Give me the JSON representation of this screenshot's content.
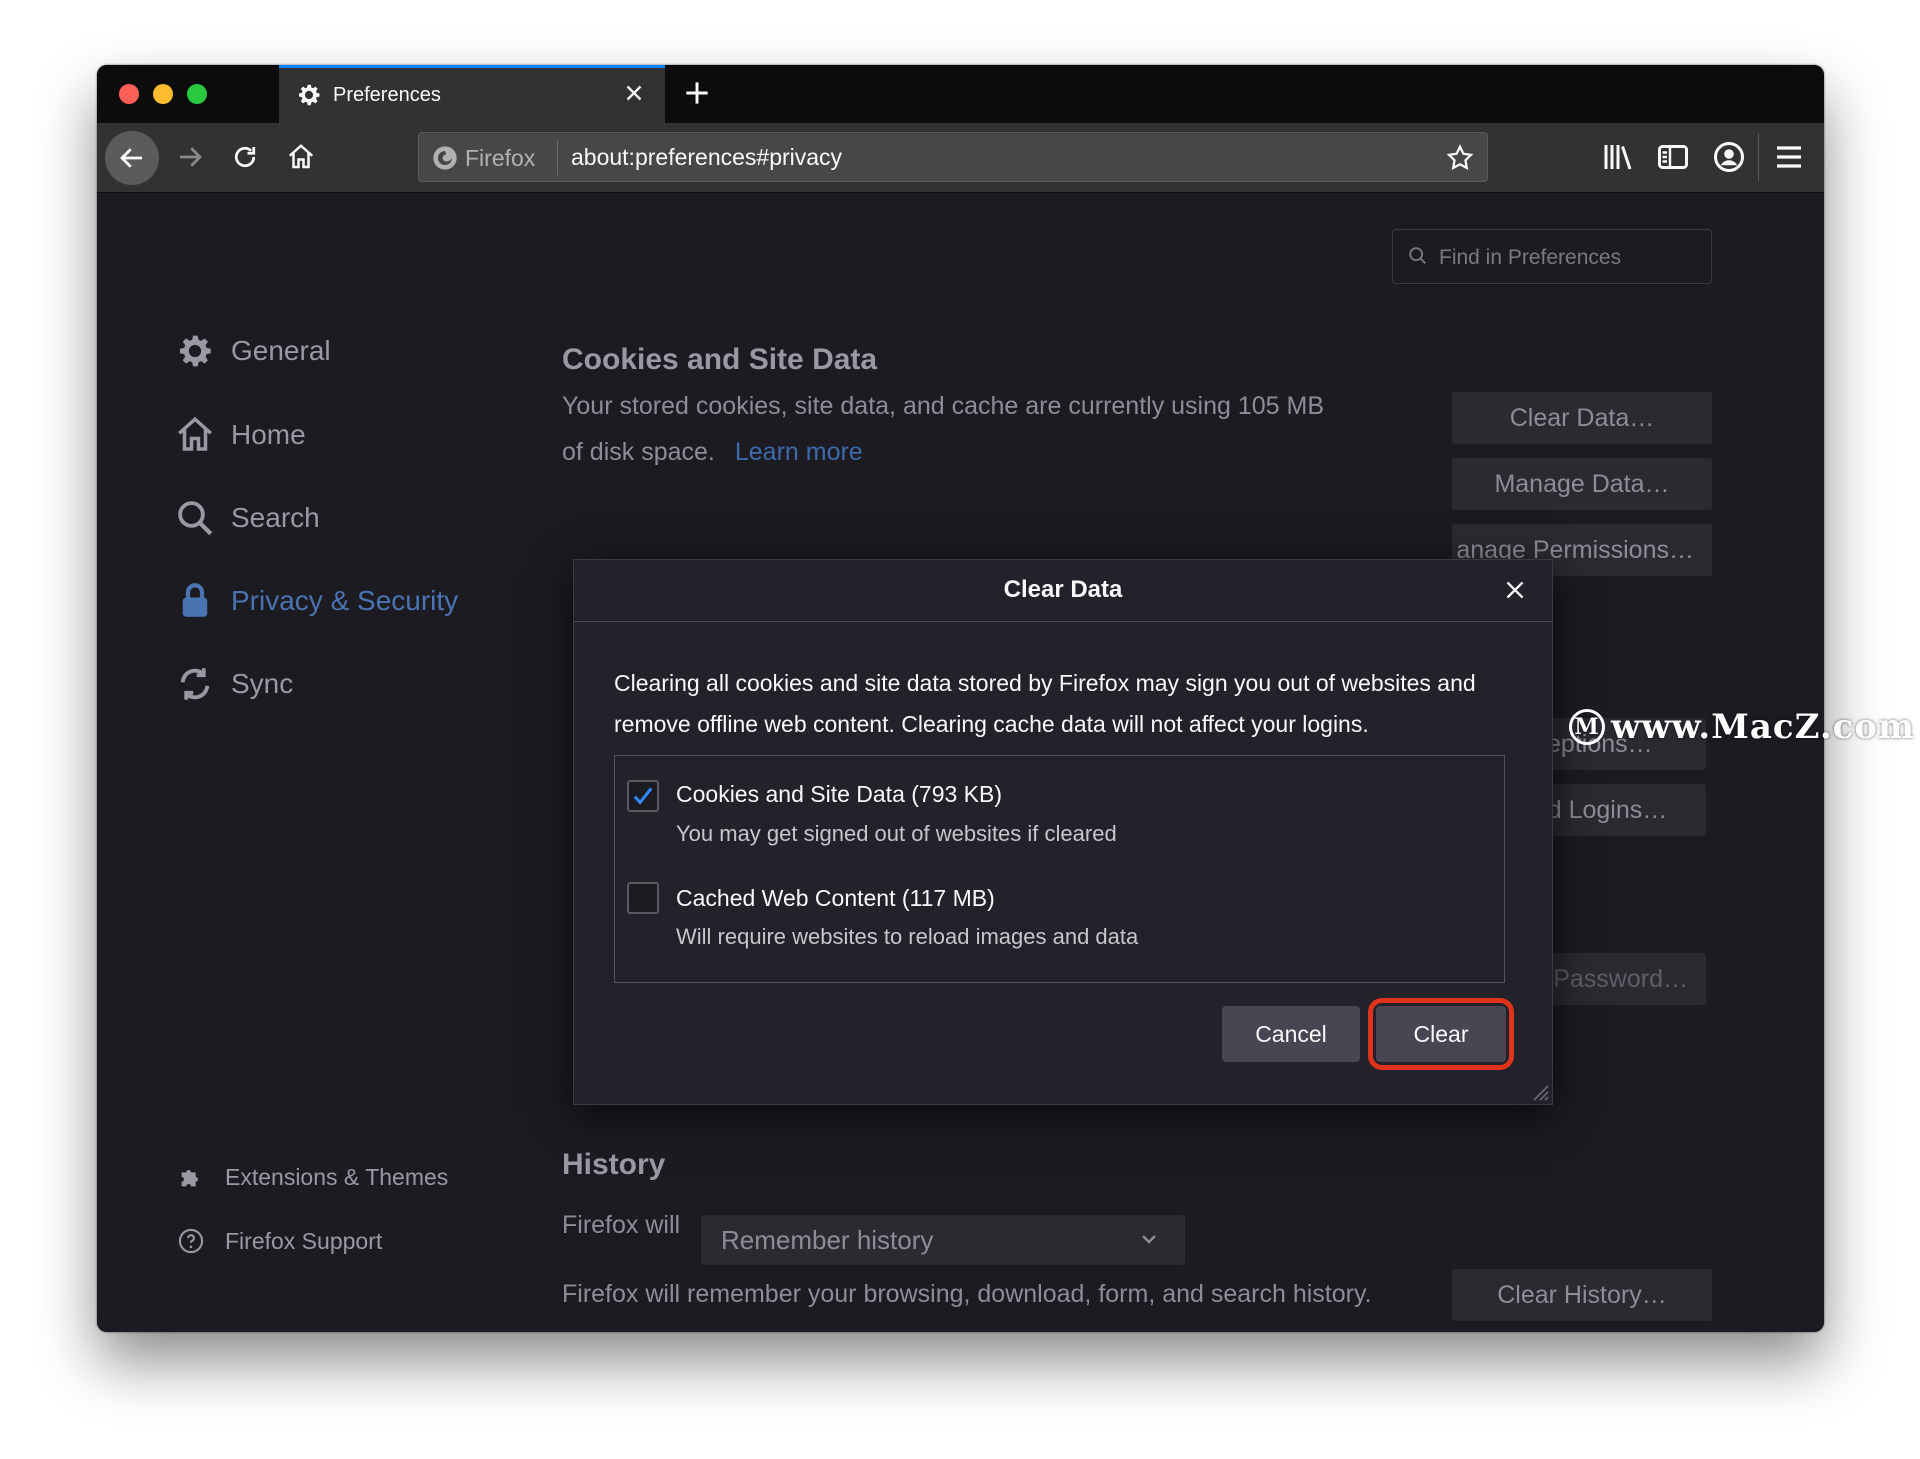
{
  "window": {
    "tab_title": "Preferences",
    "url_identity": "Firefox",
    "url": "about:preferences#privacy"
  },
  "search": {
    "placeholder": "Find in Preferences"
  },
  "sidebar": {
    "items": [
      {
        "label": "General",
        "icon": "gear-icon"
      },
      {
        "label": "Home",
        "icon": "home-icon"
      },
      {
        "label": "Search",
        "icon": "search-icon"
      },
      {
        "label": "Privacy & Security",
        "icon": "lock-icon",
        "active": true
      },
      {
        "label": "Sync",
        "icon": "sync-icon"
      }
    ],
    "footer": [
      {
        "label": "Extensions & Themes",
        "icon": "puzzle-icon"
      },
      {
        "label": "Firefox Support",
        "icon": "help-icon"
      }
    ]
  },
  "cookies": {
    "title": "Cookies and Site Data",
    "desc_line1": "Your stored cookies, site data, and cache are currently using 105 MB",
    "desc_line2": "of disk space.",
    "learn_more": "Learn more",
    "buttons": {
      "clear_data": "Clear Data…",
      "manage_data": "Manage Data…",
      "manage_permissions": "anage Permissions…"
    }
  },
  "logins": {
    "exceptions": "Exceptions…",
    "saved_logins": "Saved Logins…",
    "master_password": "e Master Password…"
  },
  "history": {
    "title": "History",
    "firefox_will": "Firefox will",
    "mode": "Remember history",
    "description": "Firefox will remember your browsing, download, form, and search history.",
    "clear_button": "Clear History…"
  },
  "dialog": {
    "title": "Clear Data",
    "message_line1": "Clearing all cookies and site data stored by Firefox may sign you out of websites and",
    "message_line2": "remove offline web content. Clearing cache data will not affect your logins.",
    "options": [
      {
        "label": "Cookies and Site Data (793 KB)",
        "sublabel": "You may get signed out of websites if cleared",
        "checked": true
      },
      {
        "label": "Cached Web Content (117 MB)",
        "sublabel": "Will require websites to reload images and data",
        "checked": false
      }
    ],
    "cancel": "Cancel",
    "clear": "Clear"
  },
  "watermark": {
    "text": "www.MacZ.com",
    "icon_letter": "M"
  },
  "colors": {
    "accent": "#0a84ff",
    "active_nav": "#4a73b1",
    "highlight_ring": "#e0341a",
    "background": "#1c1b22"
  }
}
